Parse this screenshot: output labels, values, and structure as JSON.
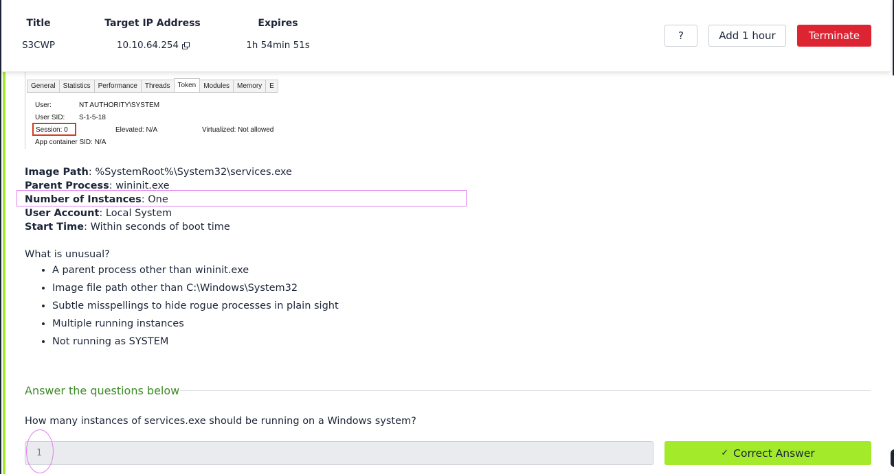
{
  "header": {
    "title_label": "Title",
    "title_value": "S3CWP",
    "ip_label": "Target IP Address",
    "ip_value": "10.10.64.254",
    "expires_label": "Expires",
    "expires_value": "1h 54min 51s",
    "help_label": "?",
    "add_hour_label": "Add 1 hour",
    "terminate_label": "Terminate"
  },
  "screenshot": {
    "tabs": [
      "General",
      "Statistics",
      "Performance",
      "Threads",
      "Token",
      "Modules",
      "Memory",
      "E"
    ],
    "active_tab": "Token",
    "user_label": "User:",
    "user_value": "NT AUTHORITY\\SYSTEM",
    "sid_label": "User SID:",
    "sid_value": "S-1-5-18",
    "session_text": "Session:  0",
    "elevated_text": "Elevated:  N/A",
    "virtualized_text": "Virtualized:  Not allowed",
    "appcontainer_text": "App container SID:    N/A"
  },
  "details": {
    "image_path_label": "Image Path",
    "image_path_value": ":  %SystemRoot%\\System32\\services.exe",
    "parent_label": "Parent Process",
    "parent_value": ":  wininit.exe",
    "instances_label": "Number of Instances",
    "instances_value": ":  One",
    "account_label": "User Account",
    "account_value": ":  Local System",
    "start_label": "Start Time",
    "start_value": ":  Within seconds of boot time"
  },
  "unusual": {
    "heading": "What is unusual?",
    "items": [
      "A parent process other than wininit.exe",
      "Image file path other than C:\\Windows\\System32",
      "Subtle misspellings to hide rogue processes in plain sight",
      "Multiple running instances",
      "Not running as SYSTEM"
    ]
  },
  "questions": {
    "heading": "Answer the questions below",
    "q1_text": "How many instances of services.exe should be running on a Windows system?",
    "q1_answer": "1",
    "correct_label": "Correct Answer"
  },
  "colors": {
    "accent_green": "#a3ea2a",
    "terminate_red": "#dc2432",
    "heading_green": "#3d8a26",
    "highlight_pink": "#e27ef0"
  }
}
